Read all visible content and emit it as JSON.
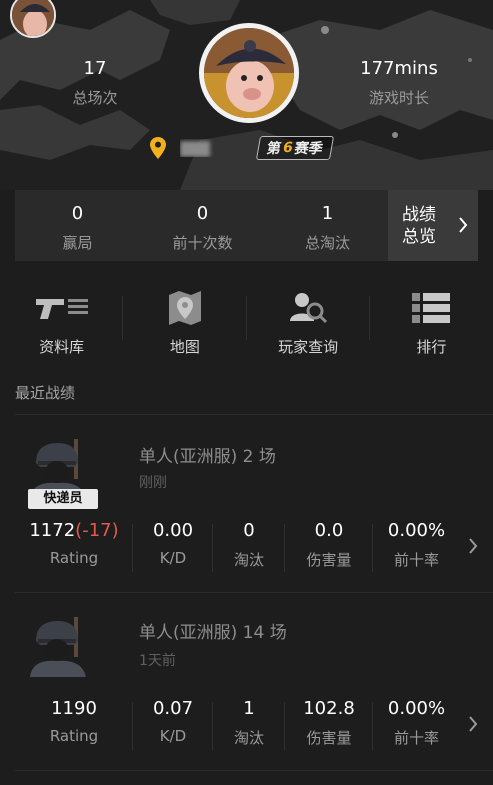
{
  "header": {
    "total_games": "17",
    "total_games_label": "总场次",
    "play_time": "177mins",
    "play_time_label": "游戏时长",
    "season_prefix": "第",
    "season_number": "6",
    "season_suffix": "赛季",
    "location_icon": "location-pin-icon",
    "accent_color": "#f2b01e"
  },
  "summary": {
    "wins": "0",
    "wins_label": "赢局",
    "top10": "0",
    "top10_label": "前十次数",
    "kills": "1",
    "kills_label": "总淘汰",
    "overview_line1": "战绩",
    "overview_line2": "总览"
  },
  "nav": [
    {
      "label": "资料库",
      "icon": "gun-icon"
    },
    {
      "label": "地图",
      "icon": "map-icon"
    },
    {
      "label": "玩家查询",
      "icon": "player-search-icon"
    },
    {
      "label": "排行",
      "icon": "ranking-icon"
    }
  ],
  "recent": {
    "title": "最近战绩",
    "matches": [
      {
        "mode": "单人(亚洲服) 2 场",
        "time": "刚刚",
        "badge": "快递员",
        "rating": "1172",
        "rating_delta": "(-17)",
        "kd": "0.00",
        "kills": "0",
        "damage": "0.0",
        "top10_rate": "0.00%"
      },
      {
        "mode": "单人(亚洲服) 14 场",
        "time": "1天前",
        "rating": "1190",
        "kd": "0.07",
        "kills": "1",
        "damage": "102.8",
        "top10_rate": "0.00%"
      }
    ],
    "labels": {
      "rating": "Rating",
      "kd": "K/D",
      "kills": "淘汰",
      "damage": "伤害量",
      "top10_rate": "前十率"
    },
    "delta_color": "#e25b4c"
  }
}
